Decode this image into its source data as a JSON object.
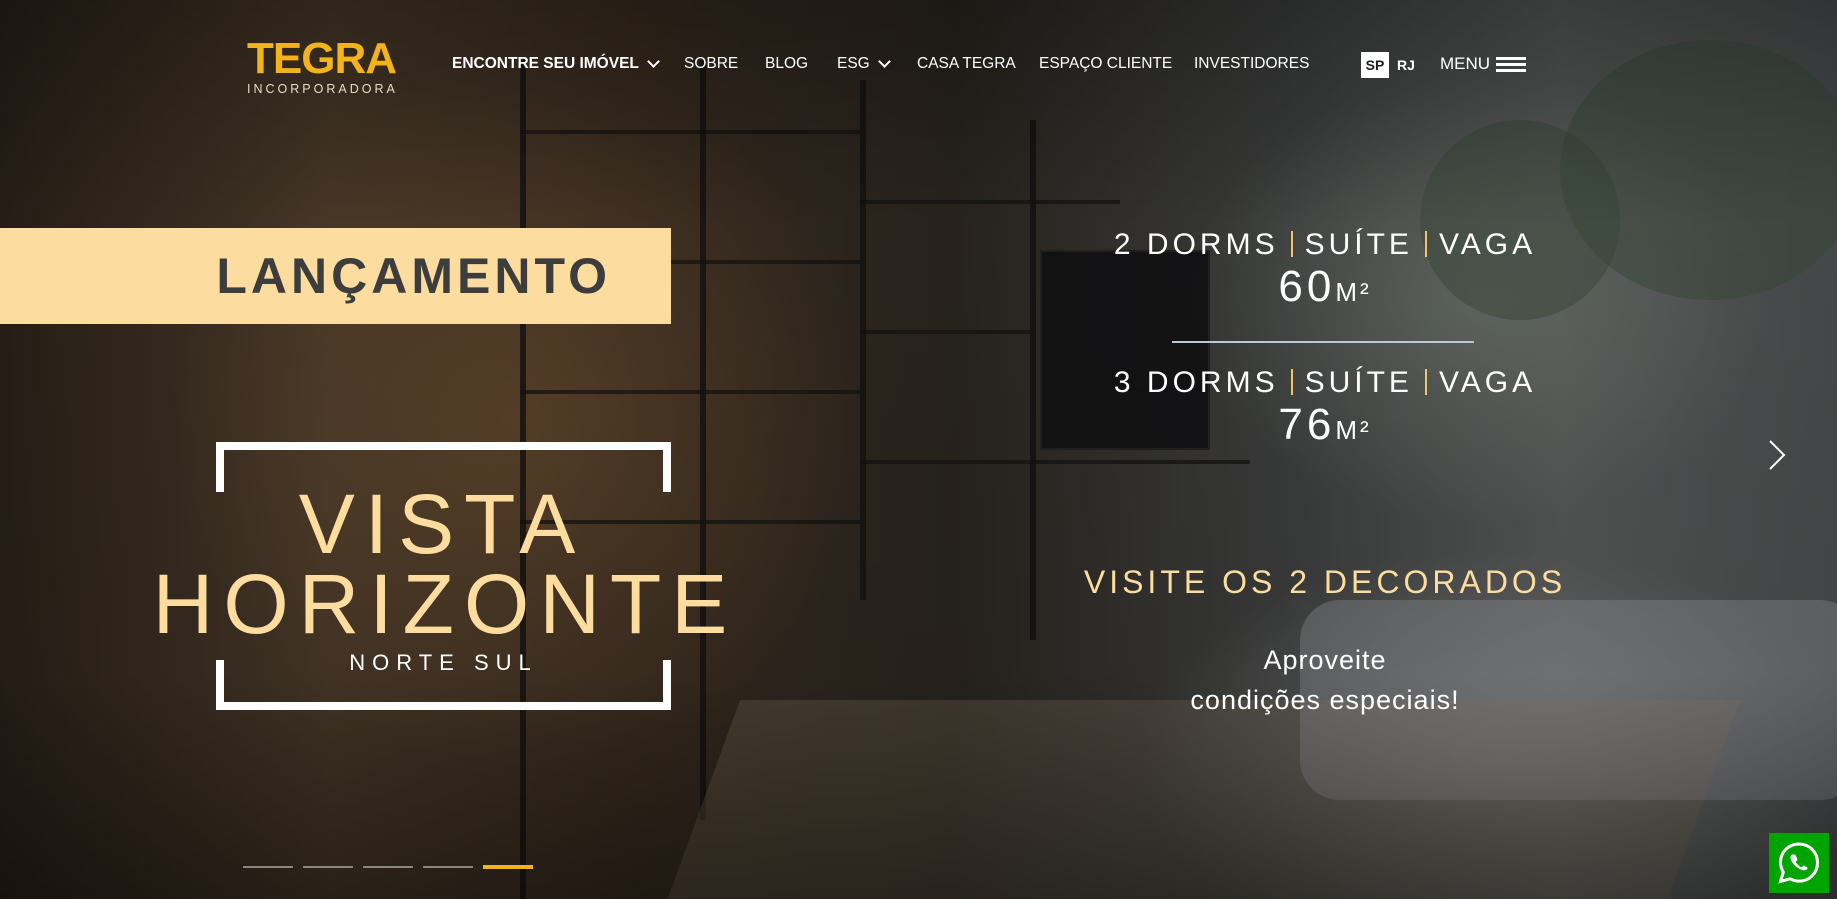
{
  "brand": {
    "name": "TEGRA",
    "tagline": "INCORPORADORA",
    "accent_color": "#f3b41b"
  },
  "nav": {
    "items": [
      {
        "label": "ENCONTRE SEU IMÓVEL",
        "dropdown": true,
        "bold": true
      },
      {
        "label": "SOBRE"
      },
      {
        "label": "BLOG"
      },
      {
        "label": "ESG",
        "dropdown": true
      },
      {
        "label": "CASA TEGRA"
      },
      {
        "label": "ESPAÇO CLIENTE"
      },
      {
        "label": "INVESTIDORES"
      }
    ],
    "regions": [
      {
        "label": "SP",
        "active": true
      },
      {
        "label": "RJ",
        "active": false
      }
    ],
    "menu_label": "MENU",
    "menu_icon": "hamburger-icon"
  },
  "hero": {
    "badge": "LANÇAMENTO",
    "badge_color": "#fddd9f",
    "project": {
      "line1": "VISTA",
      "line2": "HORIZONTE",
      "subtitle": "NORTE SUL"
    },
    "units": [
      {
        "parts": [
          "2 DORMS",
          "SUÍTE",
          "VAGA"
        ],
        "area": "60",
        "unit": "M²"
      },
      {
        "parts": [
          "3 DORMS",
          "SUÍTE",
          "VAGA"
        ],
        "area": "76",
        "unit": "M²"
      }
    ],
    "visit": "VISITE OS 2 DECORADOS",
    "promo": {
      "line1": "Aproveite",
      "line2": "condições especiais!"
    },
    "next_icon": "chevron-right-icon"
  },
  "carousel": {
    "slide_count": 5,
    "active_index": 4
  },
  "whatsapp": {
    "icon": "whatsapp-icon",
    "color": "#00a400"
  }
}
